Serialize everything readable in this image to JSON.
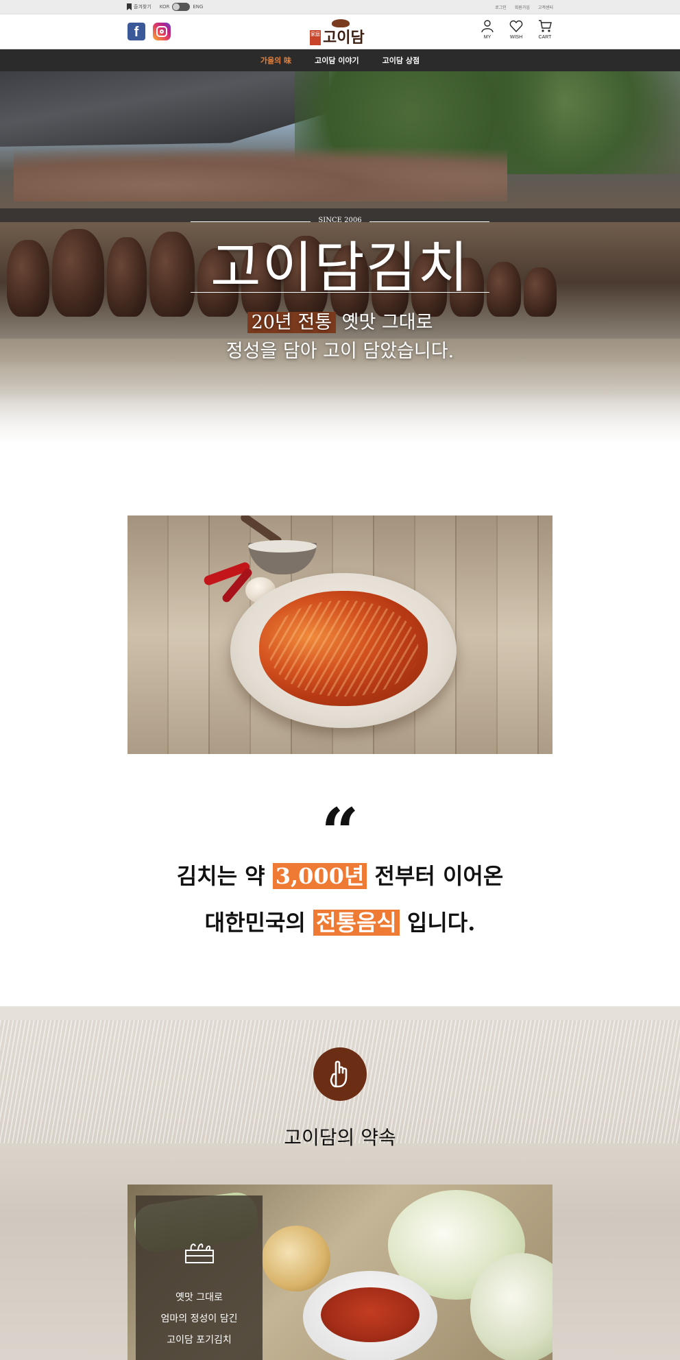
{
  "util": {
    "bookmark_label": "즐겨찾기",
    "lang_left": "KOR",
    "lang_right": "ENG",
    "links": [
      "로그인",
      "회원가입",
      "고객센터"
    ]
  },
  "header": {
    "logo_seal": "家庭",
    "logo_text": "고이담",
    "icons": [
      {
        "icon": "person-icon",
        "label": "MY"
      },
      {
        "icon": "heart-icon",
        "label": "WISH"
      },
      {
        "icon": "cart-icon",
        "label": "CART"
      }
    ]
  },
  "nav": {
    "items": [
      "가을의 味",
      "고이담 이야기",
      "고이담 상점"
    ],
    "active_index": 0
  },
  "hero": {
    "since": "SINCE 2006",
    "title": "고이담김치",
    "sub_line1_highlight": "20년 전통",
    "sub_line1_rest": " 옛맛 그대로",
    "sub_line2": "정성을 담아 고이 담았습니다."
  },
  "quote": {
    "mark": "“",
    "line1_pre": "김치는 약 ",
    "line1_highlight": "3,000년",
    "line1_post": " 전부터 이어온",
    "line2_pre": "대한민국의 ",
    "line2_highlight": "전통음식",
    "line2_post": " 입니다."
  },
  "promise": {
    "title": "고이담의 약속",
    "card_lines": [
      "옛맛 그대로",
      "엄마의 정성이 담긴",
      "고이담 포기김치"
    ]
  },
  "colors": {
    "accent": "#ef7a34",
    "brand_brown": "#6b2d14",
    "nav_bg": "#2b2b2b"
  }
}
